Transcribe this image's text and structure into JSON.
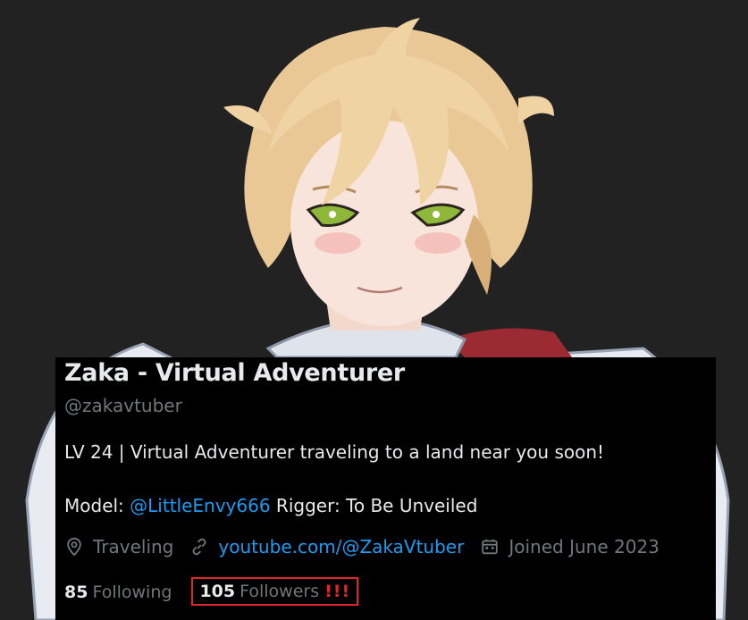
{
  "profile": {
    "display_name": "Zaka - Virtual Adventurer",
    "handle": "@zakavtuber",
    "bio_line1": "LV 24 | Virtual Adventurer traveling to a land near you soon!",
    "bio_model_prefix": "Model: ",
    "bio_model_link": "@LittleEnvy666",
    "bio_rigger": " Rigger: To Be Unveiled",
    "location": "Traveling",
    "website": "youtube.com/@ZakaVtuber",
    "joined": "Joined June 2023",
    "following_count": "85",
    "following_label": "Following",
    "followers_count": "105",
    "followers_label": "Followers",
    "followers_annotation": "!!!"
  },
  "icons": {
    "location": "location-pin-icon",
    "website": "link-icon",
    "joined": "calendar-icon"
  },
  "colors": {
    "background": "#222222",
    "card": "#000000",
    "primary_text": "#e7e9ea",
    "secondary_text": "#71767b",
    "link": "#1d9bf0",
    "highlight": "#e0262b"
  }
}
